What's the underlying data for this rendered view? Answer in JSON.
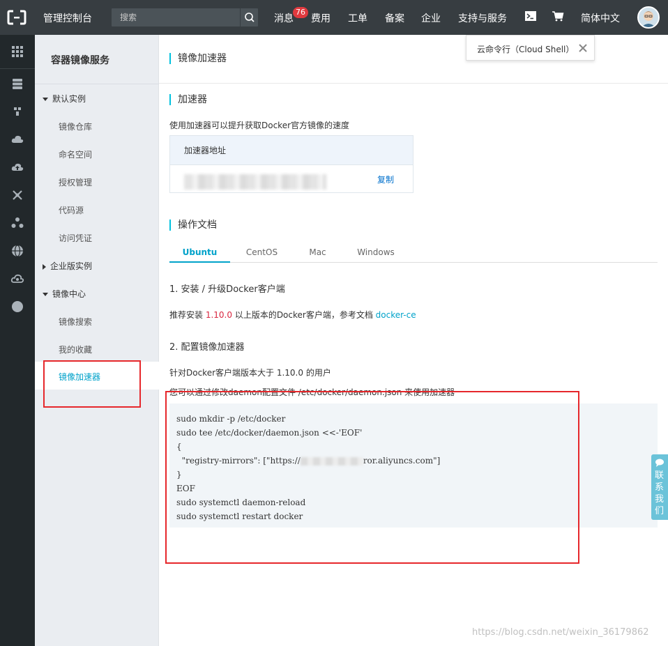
{
  "topbar": {
    "console_title": "管理控制台",
    "search_placeholder": "搜索",
    "nav": {
      "messages": "消息",
      "messages_badge": "76",
      "billing": "费用",
      "tickets": "工单",
      "filing": "备案",
      "enterprise": "企业",
      "support": "支持与服务",
      "language": "简体中文"
    }
  },
  "tooltip": {
    "text": "云命令行（Cloud Shell）"
  },
  "sidebar": {
    "title": "容器镜像服务",
    "groups": [
      {
        "label": "默认实例",
        "items": [
          "镜像仓库",
          "命名空间",
          "授权管理",
          "代码源",
          "访问凭证"
        ]
      },
      {
        "label": "企业版实例",
        "items": []
      },
      {
        "label": "镜像中心",
        "items": [
          "镜像搜索",
          "我的收藏",
          "镜像加速器"
        ]
      }
    ],
    "active_item": "镜像加速器"
  },
  "main": {
    "page_title": "镜像加速器",
    "accelerator": {
      "title": "加速器",
      "desc": "使用加速器可以提升获取Docker官方镜像的速度",
      "table_header": "加速器地址",
      "copy_label": "复制"
    },
    "docs": {
      "title": "操作文档",
      "tabs": [
        "Ubuntu",
        "CentOS",
        "Mac",
        "Windows"
      ],
      "active_tab": "Ubuntu",
      "step1": {
        "title": "1. 安装 / 升级Docker客户端",
        "desc_prefix": "推荐安装 ",
        "version": "1.10.0",
        "desc_mid": " 以上版本的Docker客户端，参考文档 ",
        "doc_link": "docker-ce"
      },
      "step2": {
        "title": "2. 配置镜像加速器",
        "desc1": "针对Docker客户端版本大于 1.10.0 的用户",
        "desc2": "您可以通过修改daemon配置文件 /etc/docker/daemon.json 来使用加速器"
      },
      "code": {
        "line1": "sudo mkdir -p /etc/docker",
        "line2": "sudo tee /etc/docker/daemon.json <<-'EOF'",
        "line3": "{",
        "line4_prefix": "  \"registry-mirrors\": [\"https://",
        "line4_suffix": "ror.aliyuncs.com\"]",
        "line5": "}",
        "line6": "EOF",
        "line7": "sudo systemctl daemon-reload",
        "line8": "sudo systemctl restart docker"
      }
    }
  },
  "contact": {
    "label": "联系我们"
  },
  "watermark": "https://blog.csdn.net/weixin_36179862",
  "colors": {
    "topbar": "#373d41",
    "iconbar": "#22282b",
    "accent": "#00a2ca",
    "annotation": "#e6272b"
  }
}
